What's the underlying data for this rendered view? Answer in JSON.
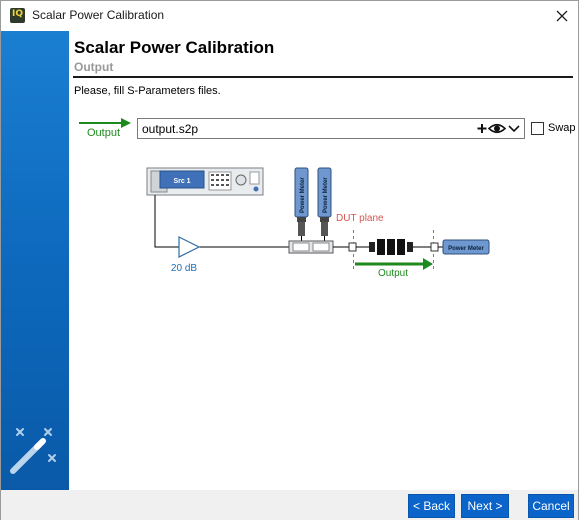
{
  "window": {
    "title": "Scalar Power Calibration",
    "app_icon_text": "IQ"
  },
  "header": {
    "title": "Scalar Power Calibration",
    "subtitle": "Output"
  },
  "instruction": "Please, fill S-Parameters files.",
  "file_row": {
    "port_label": "Output",
    "value": "output.s2p",
    "swap_label": "Swap",
    "swap_checked": false
  },
  "diagram": {
    "source_label": "Src 1",
    "amp_gain": "20 dB",
    "power_meter_label": "Power Meter",
    "dut_plane_label": "DUT plane",
    "output_label": "Output"
  },
  "footer": {
    "back_label": "< Back",
    "next_label": "Next >",
    "cancel_label": "Cancel"
  },
  "colors": {
    "accent_blue": "#0a64c9",
    "output_green": "#1e8a1e",
    "dut_red": "#d9534f",
    "gain_blue": "#1f6fb8"
  }
}
